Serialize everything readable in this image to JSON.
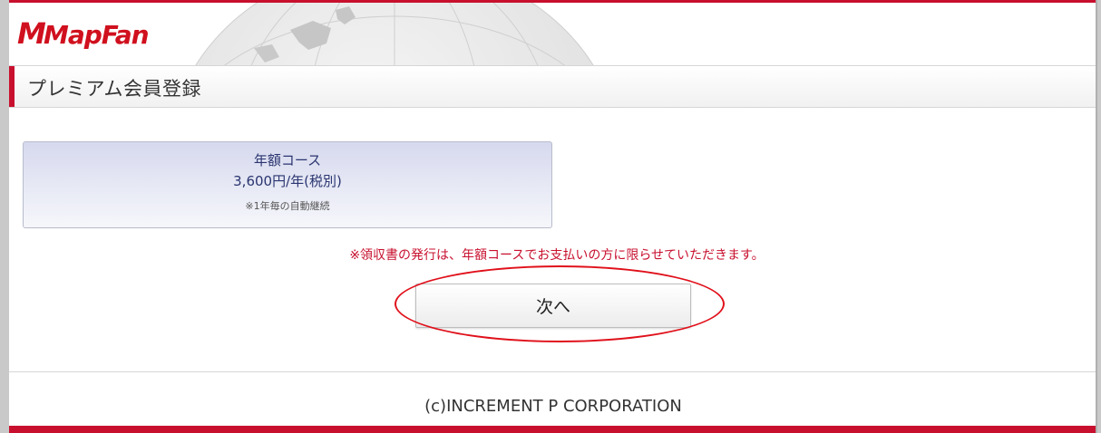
{
  "header": {
    "logo_text": "MapFan",
    "logo_icon": "mapfan-logo",
    "globe_icon": "globe-watermark-icon"
  },
  "page": {
    "title": "プレミアム会員登録"
  },
  "plan": {
    "name": "年額コース",
    "price": "3,600円/年(税別)",
    "note": "※1年毎の自動継続"
  },
  "notice": "※領収書の発行は、年額コースでお支払いの方に限らせていただきます。",
  "actions": {
    "next_label": "次へ"
  },
  "footer": {
    "copyright": "(c)INCREMENT P CORPORATION"
  },
  "colors": {
    "brand_red": "#c8102e",
    "plan_text": "#2a3570",
    "annotation_red": "#e0101a"
  }
}
